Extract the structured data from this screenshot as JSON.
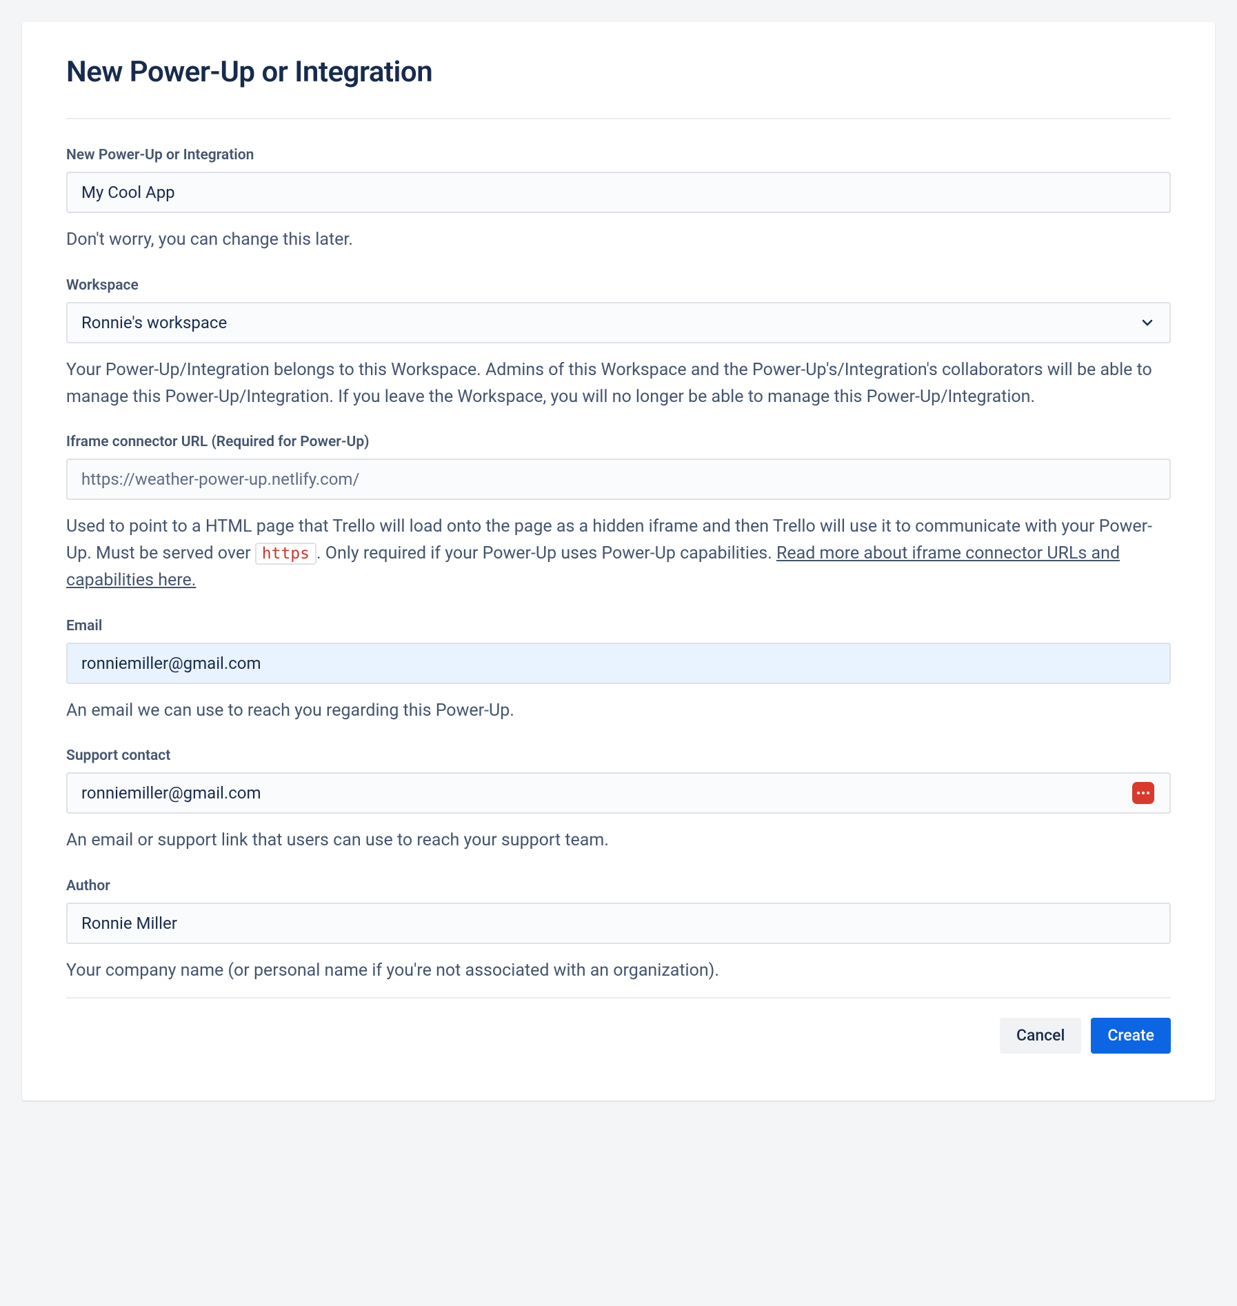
{
  "page": {
    "title": "New Power-Up or Integration"
  },
  "fields": {
    "name": {
      "label": "New Power-Up or Integration",
      "value": "My Cool App",
      "help": "Don't worry, you can change this later."
    },
    "workspace": {
      "label": "Workspace",
      "selected": "Ronnie's workspace",
      "help": "Your Power-Up/Integration belongs to this Workspace. Admins of this Workspace and the Power-Up's/Integration's collaborators will be able to manage this Power-Up/Integration. If you leave the Workspace, you will no longer be able to manage this Power-Up/Integration."
    },
    "iframe": {
      "label": "Iframe connector URL (Required for Power-Up)",
      "placeholder": "https://weather-power-up.netlify.com/",
      "help_pre": "Used to point to a HTML page that Trello will load onto the page as a hidden iframe and then Trello will use it to communicate with your Power-Up. Must be served over ",
      "help_code": "https",
      "help_post": ". Only required if your Power-Up uses Power-Up capabilities. ",
      "help_link": "Read more about iframe connector URLs and capabilities here."
    },
    "email": {
      "label": "Email",
      "value": "ronniemiller@gmail.com",
      "help": "An email we can use to reach you regarding this Power-Up."
    },
    "support": {
      "label": "Support contact",
      "value": "ronniemiller@gmail.com",
      "help": "An email or support link that users can use to reach your support team."
    },
    "author": {
      "label": "Author",
      "value": "Ronnie Miller",
      "help": "Your company name (or personal name if you're not associated with an organization)."
    }
  },
  "buttons": {
    "cancel": "Cancel",
    "create": "Create"
  }
}
